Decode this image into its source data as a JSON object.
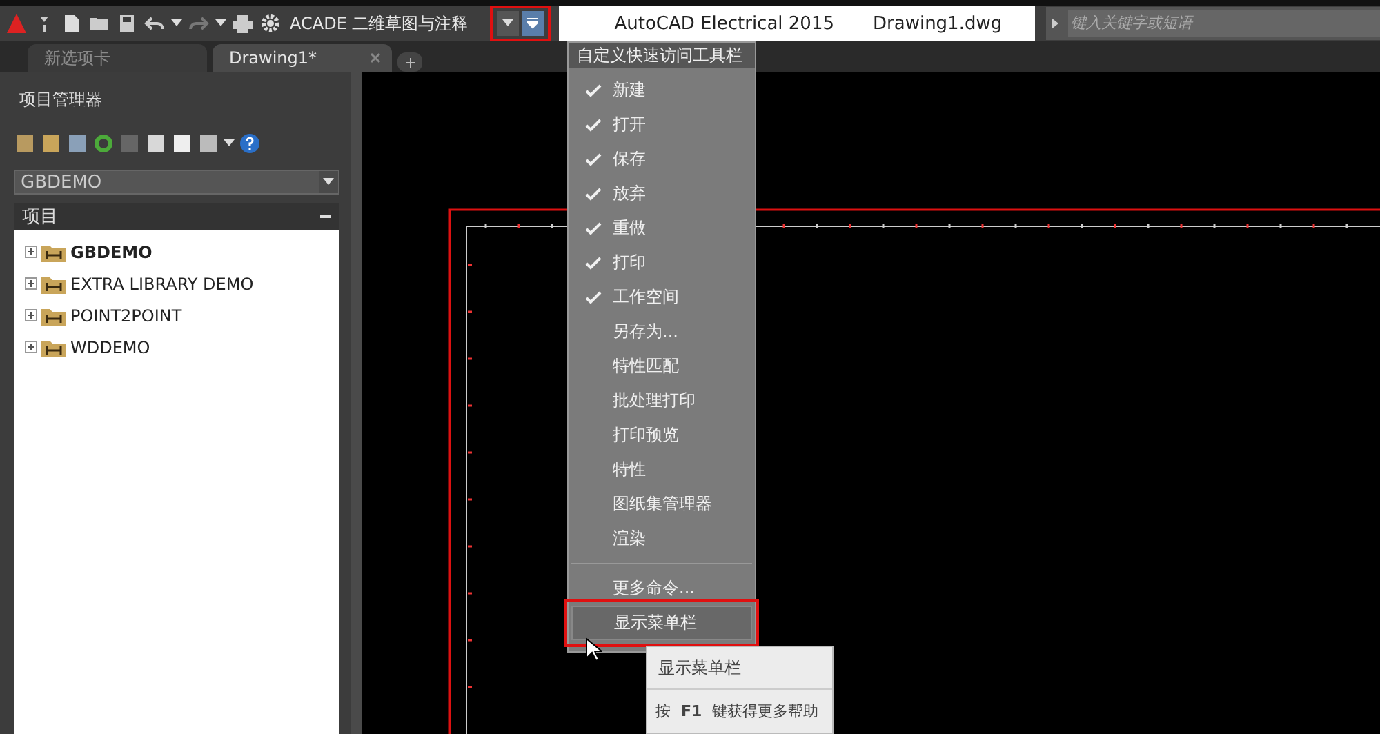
{
  "title_bar": {
    "workspace": "ACADE 二维草图与注释",
    "qat_dropdown_highlighted": true,
    "app_name": "AutoCAD Electrical 2015",
    "document": "Drawing1.dwg",
    "search": {
      "placeholder": "键入关键字或短语"
    }
  },
  "tabs": [
    {
      "label": "新选项卡",
      "selected": false,
      "closable": false
    },
    {
      "label": "Drawing1*",
      "selected": true,
      "closable": true
    }
  ],
  "project_manager": {
    "title": "项目管理器",
    "project_select": "GBDEMO",
    "section": "项目",
    "projects": [
      {
        "label": "GBDEMO",
        "active": true
      },
      {
        "label": "EXTRA LIBRARY DEMO",
        "active": false
      },
      {
        "label": "POINT2POINT",
        "active": false
      },
      {
        "label": "WDDEMO",
        "active": false
      }
    ]
  },
  "qat_menu": {
    "title": "自定义快速访问工具栏",
    "items": [
      {
        "label": "新建",
        "checked": true,
        "selected": false,
        "highlighted": false
      },
      {
        "label": "打开",
        "checked": true,
        "selected": false,
        "highlighted": false
      },
      {
        "label": "保存",
        "checked": true,
        "selected": false,
        "highlighted": false
      },
      {
        "label": "放弃",
        "checked": true,
        "selected": false,
        "highlighted": false
      },
      {
        "label": "重做",
        "checked": true,
        "selected": false,
        "highlighted": false
      },
      {
        "label": "打印",
        "checked": true,
        "selected": false,
        "highlighted": false
      },
      {
        "label": "工作空间",
        "checked": true,
        "selected": false,
        "highlighted": false
      },
      {
        "label": "另存为...",
        "checked": false,
        "selected": false,
        "highlighted": false
      },
      {
        "label": "特性匹配",
        "checked": false,
        "selected": false,
        "highlighted": false
      },
      {
        "label": "批处理打印",
        "checked": false,
        "selected": false,
        "highlighted": false
      },
      {
        "label": "打印预览",
        "checked": false,
        "selected": false,
        "highlighted": false
      },
      {
        "label": "特性",
        "checked": false,
        "selected": false,
        "highlighted": false
      },
      {
        "label": "图纸集管理器",
        "checked": false,
        "selected": false,
        "highlighted": false
      },
      {
        "label": "渲染",
        "checked": false,
        "selected": false,
        "highlighted": false
      }
    ],
    "more_items": [
      {
        "label": "更多命令...",
        "checked": false,
        "selected": false,
        "highlighted": false
      },
      {
        "label": "显示菜单栏",
        "checked": false,
        "selected": true,
        "highlighted": true
      }
    ]
  },
  "tooltip": {
    "title": "显示菜单栏",
    "help": "按 **F1** 键获得更多帮助"
  }
}
